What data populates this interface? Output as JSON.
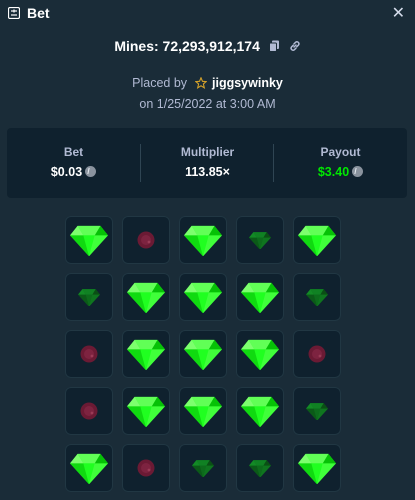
{
  "window": {
    "title": "Bet",
    "close_label": "✕"
  },
  "bet": {
    "mines_text": "Mines: 72,293,912,174",
    "placed_prefix": "Placed by",
    "username": "jiggsywinky",
    "date_text": "on 1/25/2022 at 3:00 AM"
  },
  "stats": {
    "bet": {
      "label": "Bet",
      "value": "$0.03"
    },
    "multiplier": {
      "label": "Multiplier",
      "value": "113.85×"
    },
    "payout": {
      "label": "Payout",
      "value": "$3.40"
    }
  },
  "colors": {
    "payout_green": "#00e701",
    "gem_bright": "#20ff20",
    "gem_dim": "#0d6b1c",
    "mine": "#6b1a34"
  },
  "grid": {
    "rows": [
      [
        "gem",
        "mine-dim",
        "gem",
        "gem-dim",
        "gem"
      ],
      [
        "gem-dim",
        "gem",
        "gem",
        "gem",
        "gem-dim"
      ],
      [
        "mine-dim",
        "gem",
        "gem",
        "gem",
        "mine-dim"
      ],
      [
        "mine-dim",
        "gem",
        "gem",
        "gem",
        "gem-dim"
      ],
      [
        "gem",
        "mine-dim",
        "gem-dim",
        "gem-dim",
        "gem"
      ]
    ]
  }
}
